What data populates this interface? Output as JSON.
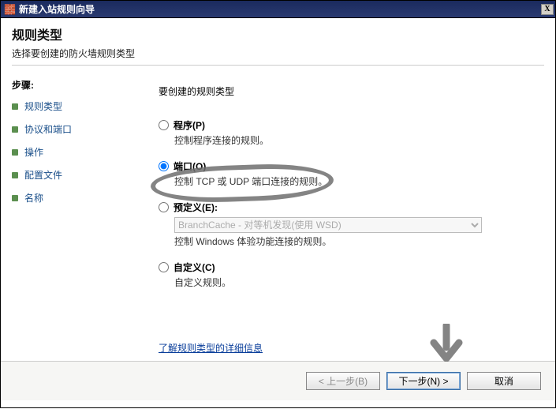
{
  "window": {
    "title": "新建入站规则向导",
    "close_label": "X"
  },
  "header": {
    "heading": "规则类型",
    "subtitle": "选择要创建的防火墙规则类型"
  },
  "sidebar": {
    "steps_label": "步骤:",
    "items": [
      {
        "label": "规则类型",
        "current": true
      },
      {
        "label": "协议和端口",
        "current": false
      },
      {
        "label": "操作",
        "current": false
      },
      {
        "label": "配置文件",
        "current": false
      },
      {
        "label": "名称",
        "current": false
      }
    ]
  },
  "main": {
    "prompt": "要创建的规则类型",
    "options": {
      "program": {
        "title": "程序(P)",
        "desc": "控制程序连接的规则。"
      },
      "port": {
        "title": "端口(O)",
        "desc": "控制 TCP 或 UDP 端口连接的规则。"
      },
      "predefined": {
        "title": "预定义(E):",
        "select_value": "BranchCache - 对等机发现(使用 WSD)",
        "desc": "控制 Windows 体验功能连接的规则。"
      },
      "custom": {
        "title": "自定义(C)",
        "desc": "自定义规则。"
      }
    },
    "link": "了解规则类型的详细信息"
  },
  "buttons": {
    "back": "< 上一步(B)",
    "next": "下一步(N) >",
    "cancel": "取消"
  }
}
